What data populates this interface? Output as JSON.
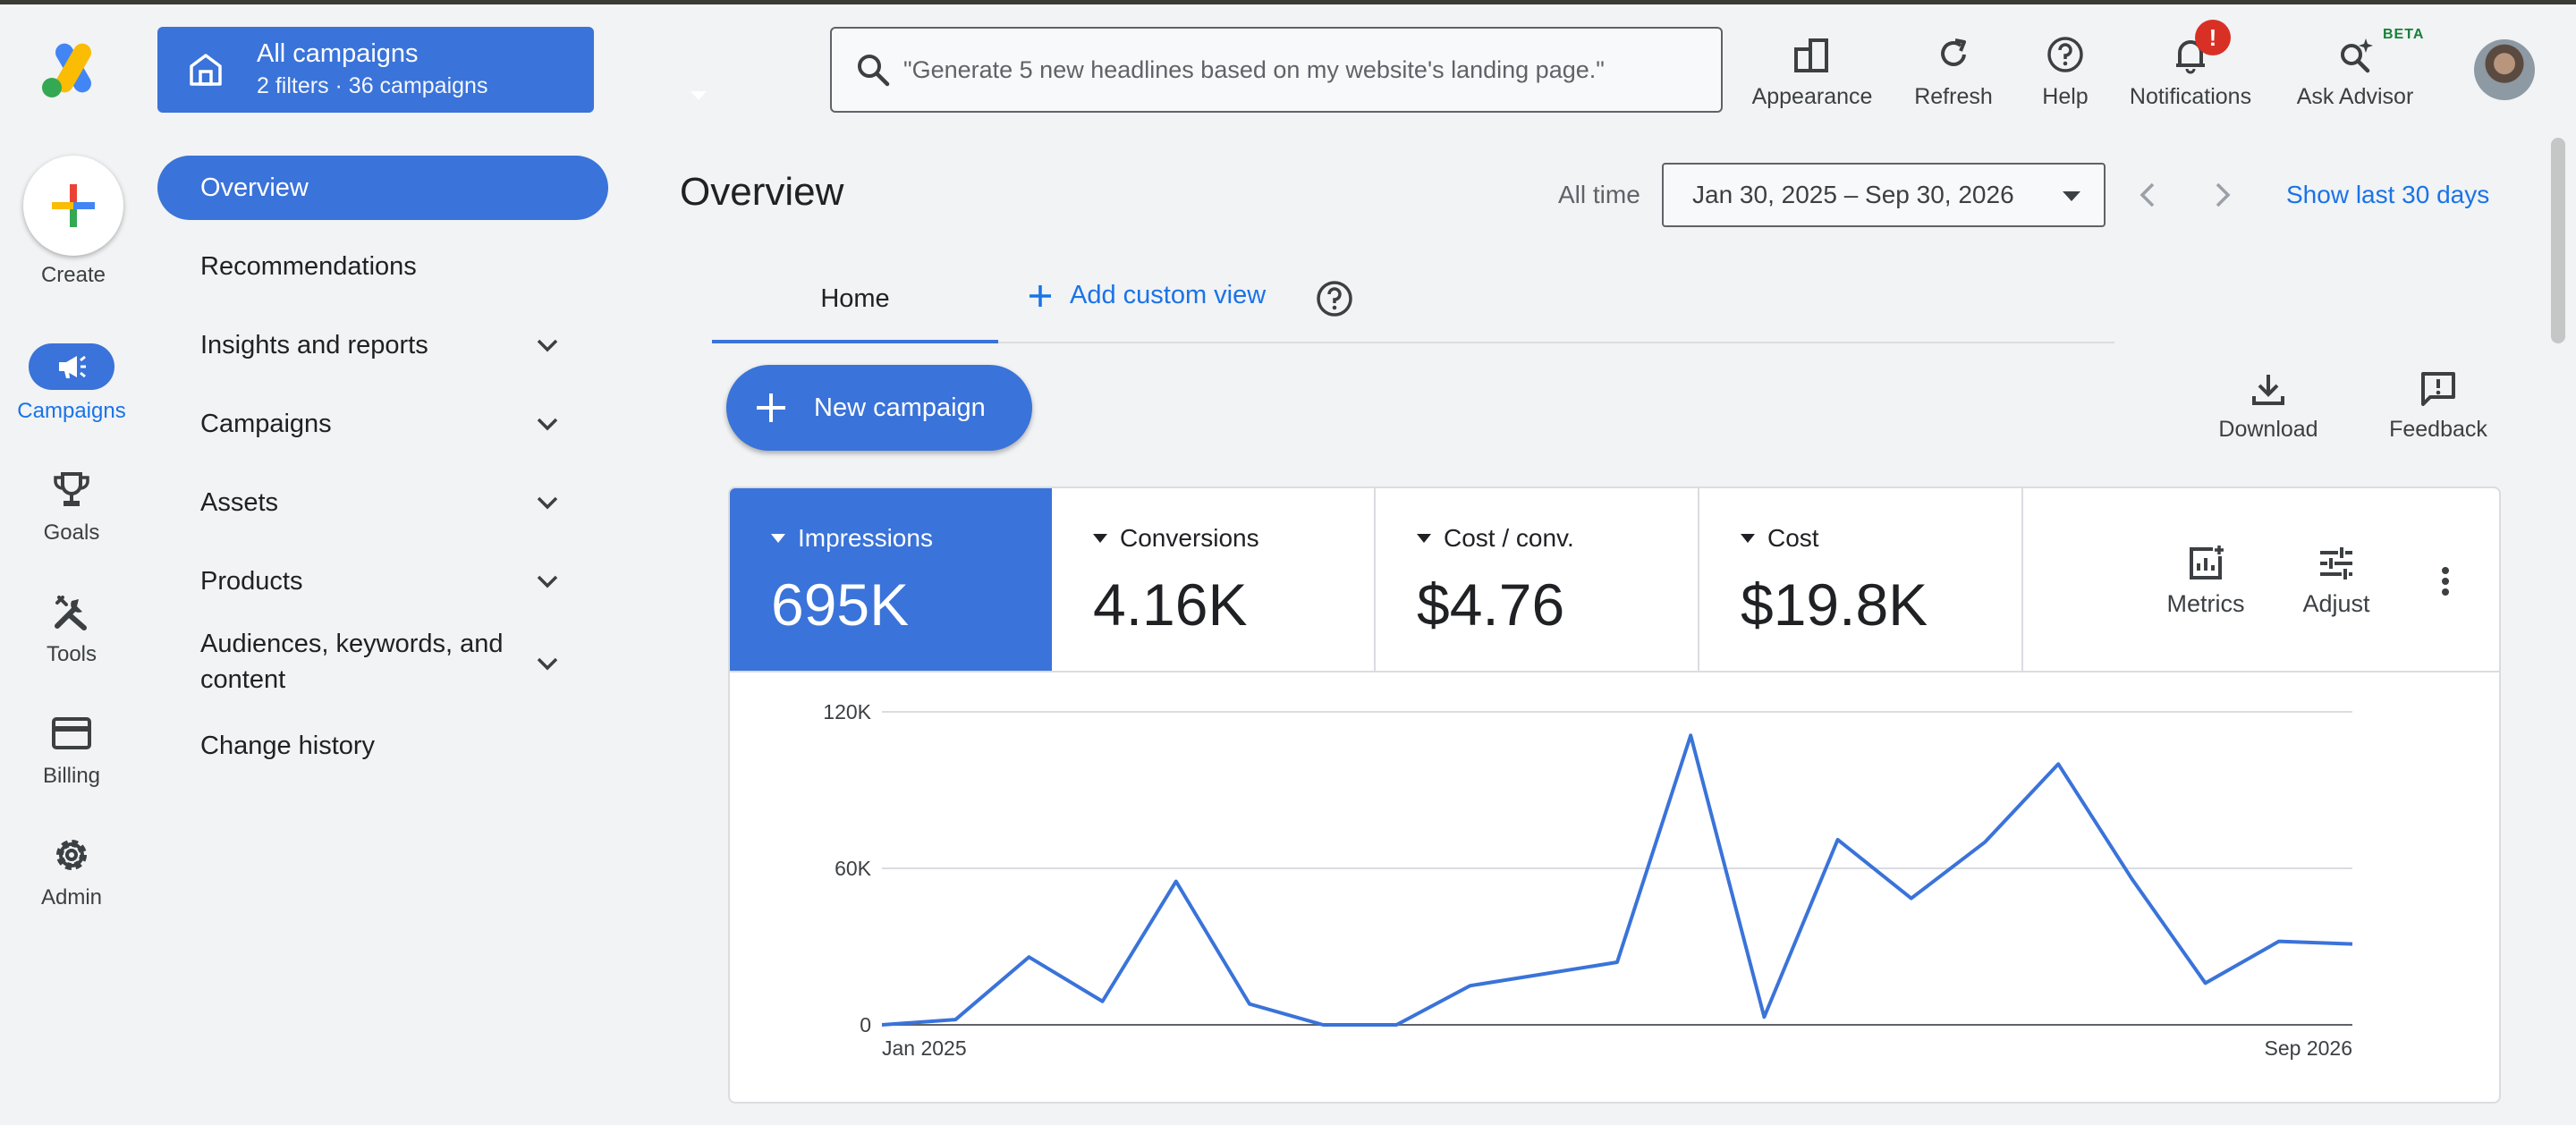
{
  "scope": {
    "title": "All campaigns",
    "subtitle": "2 filters · 36 campaigns"
  },
  "search": {
    "placeholder": "\"Generate 5 new headlines based on my website's landing page.\""
  },
  "header_actions": {
    "appearance": "Appearance",
    "refresh": "Refresh",
    "help": "Help",
    "notifications": "Notifications",
    "notifications_badge": "!",
    "ask_advisor": "Ask Advisor",
    "beta": "BETA"
  },
  "rail": {
    "create": "Create",
    "campaigns": "Campaigns",
    "goals": "Goals",
    "tools": "Tools",
    "billing": "Billing",
    "admin": "Admin"
  },
  "nav": {
    "overview": "Overview",
    "recommendations": "Recommendations",
    "insights": "Insights and reports",
    "campaigns": "Campaigns",
    "assets": "Assets",
    "products": "Products",
    "audiences_line1": "Audiences, keywords, and",
    "audiences_line2": "content",
    "change_history": "Change history"
  },
  "main": {
    "title": "Overview",
    "all_time": "All time",
    "date_range": "Jan 30, 2025 – Sep 30, 2026",
    "show_last": "Show last 30 days",
    "tab_home": "Home",
    "tab_add": "Add custom view",
    "new_campaign": "New campaign",
    "download": "Download",
    "feedback": "Feedback"
  },
  "metrics": {
    "impressions": {
      "name": "Impressions",
      "value": "695K"
    },
    "conversions": {
      "name": "Conversions",
      "value": "4.16K"
    },
    "cost_conv": {
      "name": "Cost / conv.",
      "value": "$4.76"
    },
    "cost": {
      "name": "Cost",
      "value": "$19.8K"
    },
    "metrics_btn": "Metrics",
    "adjust_btn": "Adjust"
  },
  "colors": {
    "accent": "#3a73d9",
    "link": "#1a73e8",
    "line": "#3a73d9"
  },
  "chart_data": {
    "type": "line",
    "ytick_labels": [
      "120K",
      "60K",
      "0"
    ],
    "yticks": [
      120000,
      60000,
      0
    ],
    "ylim": [
      0,
      120000
    ],
    "x_start_label": "Jan 2025",
    "x_end_label": "Sep 2026",
    "grid": true,
    "series": [
      {
        "values": [
          0,
          2000,
          26000,
          9000,
          55000,
          8000,
          0,
          0,
          15000,
          19500,
          24000,
          111000,
          3000,
          71000,
          48500,
          70000,
          100000,
          56000,
          16000,
          32000,
          31000
        ]
      }
    ]
  }
}
